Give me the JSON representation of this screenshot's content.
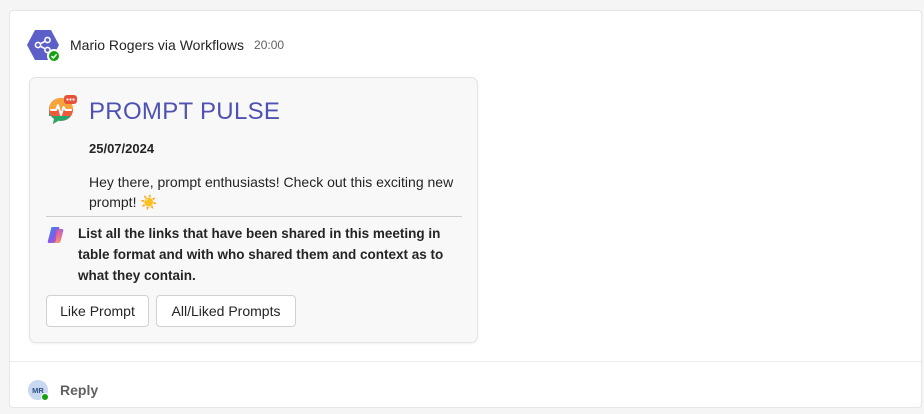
{
  "message": {
    "sender": "Mario Rogers via Workflows",
    "time": "20:00",
    "avatar_icon": "workflow-share-icon",
    "presence_status": "available"
  },
  "card": {
    "logo_icon": "prompt-pulse-logo-icon",
    "title": "PROMPT PULSE",
    "date": "25/07/2024",
    "intro": "Hey there, prompt enthusiasts! Check out this exciting new prompt! ☀️",
    "prompt_icon": "copilot-icon",
    "prompt_text": "List all the links that have been shared in this meeting in table format and with who shared them and context as to what they contain.",
    "buttons": {
      "like": "Like Prompt",
      "all_liked": "All/Liked Prompts"
    },
    "title_color": "#4f52b2"
  },
  "reply": {
    "avatar_initials": "MR",
    "label": "Reply"
  }
}
